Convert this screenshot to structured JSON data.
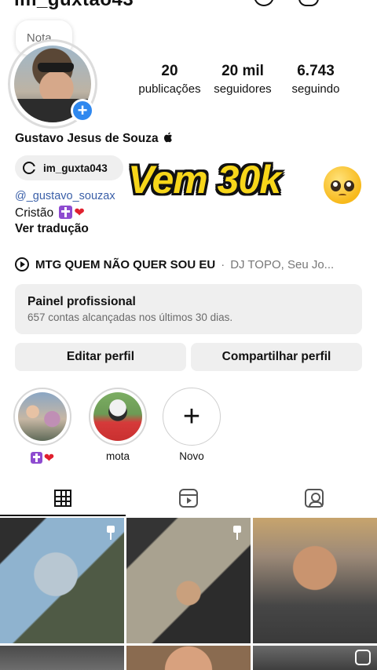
{
  "header": {
    "username": "im_guxtao43"
  },
  "note": {
    "placeholder": "Nota..."
  },
  "profile": {
    "full_name": "Gustavo Jesus de Souza",
    "threads_handle": "im_guxta043",
    "mention": "@_gustavo_souzax",
    "bio_line1": "Cristão",
    "see_translation": "Ver tradução"
  },
  "stats": [
    {
      "value": "20",
      "label": "publicações"
    },
    {
      "value": "20 mil",
      "label": "seguidores"
    },
    {
      "value": "6.743",
      "label": "seguindo"
    }
  ],
  "overlay": {
    "text": "Vem 30k"
  },
  "music": {
    "song": "MTG QUEM NÃO QUER SOU EU",
    "separator": "·",
    "artist": "DJ TOPO, Seu Jo..."
  },
  "professional_panel": {
    "title": "Painel profissional",
    "subtitle": "657 contas alcançadas nos últimos 30 dias."
  },
  "actions": {
    "edit_profile": "Editar perfil",
    "share_profile": "Compartilhar perfil"
  },
  "highlights": [
    {
      "label": "",
      "emoji": "heart"
    },
    {
      "label": "mota"
    },
    {
      "label": "Novo"
    }
  ],
  "tabs": [
    "grid",
    "reels",
    "tagged"
  ],
  "colors": {
    "accent_blue": "#2f88ef",
    "overlay_yellow": "#f7d61a",
    "chip_bg": "#efefef"
  }
}
